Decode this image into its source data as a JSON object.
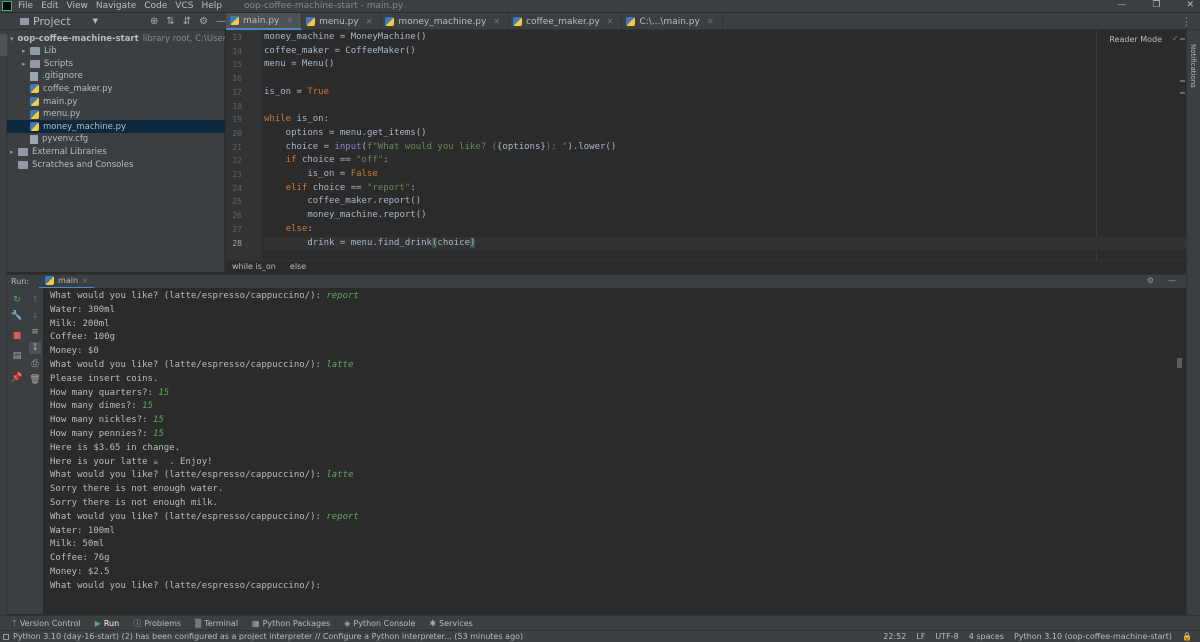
{
  "window": {
    "title": "oop-coffee-machine-start - main.py",
    "menu": [
      "File",
      "Edit",
      "View",
      "Navigate",
      "Code",
      "VCS",
      "Help"
    ]
  },
  "toolbar": {
    "project_selector": "Project",
    "tabs": [
      "main.py",
      "menu.py",
      "money_machine.py",
      "coffee_maker.py",
      "C:\\...\\main.py"
    ]
  },
  "project_tree": [
    {
      "label": "oop-coffee-machine-start",
      "hint": "library root,  C:\\Users\\SSLCor",
      "kind": "folder",
      "indent": 0,
      "expanded": true
    },
    {
      "label": "Lib",
      "kind": "folder",
      "indent": 1,
      "expanded": false
    },
    {
      "label": "Scripts",
      "kind": "folder",
      "indent": 1,
      "expanded": false
    },
    {
      "label": ".gitignore",
      "kind": "txt",
      "indent": 1
    },
    {
      "label": "coffee_maker.py",
      "kind": "py",
      "indent": 1
    },
    {
      "label": "main.py",
      "kind": "py",
      "indent": 1
    },
    {
      "label": "menu.py",
      "kind": "py",
      "indent": 1
    },
    {
      "label": "money_machine.py",
      "kind": "py",
      "indent": 1,
      "selected": true
    },
    {
      "label": "pyvenv.cfg",
      "kind": "txt",
      "indent": 1
    },
    {
      "label": "External Libraries",
      "kind": "folder",
      "indent": 0,
      "expanded": false
    },
    {
      "label": "Scratches and Consoles",
      "kind": "folder",
      "indent": 0
    }
  ],
  "editor": {
    "reader_mode": "Reader Mode",
    "lines": [
      {
        "n": "13",
        "html": "money_machine = MoneyMachine()"
      },
      {
        "n": "14",
        "html": "coffee_maker = CoffeeMaker()"
      },
      {
        "n": "15",
        "html": "menu = Menu()"
      },
      {
        "n": "16",
        "html": ""
      },
      {
        "n": "17",
        "html": "is_on = <span class=\"kw\">True</span>"
      },
      {
        "n": "18",
        "html": ""
      },
      {
        "n": "19",
        "html": "<span class=\"kw\">while</span> is_on:"
      },
      {
        "n": "20",
        "html": "    options = menu.get_items()"
      },
      {
        "n": "21",
        "html": "    choice = <span class=\"fn\">input</span>(<span class=\"str\">f\"What would you like? (</span>{options}<span class=\"str\">): \"</span>).lower()"
      },
      {
        "n": "22",
        "html": "    <span class=\"kw\">if</span> choice == <span class=\"str\">\"off\"</span>:"
      },
      {
        "n": "23",
        "html": "        is_on = <span class=\"kw\">False</span>"
      },
      {
        "n": "24",
        "html": "    <span class=\"kw\">elif</span> choice == <span class=\"str\">\"report\"</span>:"
      },
      {
        "n": "25",
        "html": "        coffee_maker.report()"
      },
      {
        "n": "26",
        "html": "        money_machine.report()"
      },
      {
        "n": "27",
        "html": "    <span class=\"kw\">else</span>:"
      },
      {
        "n": "28",
        "html": "        drink = menu.find_drink<span class=\"paren\">(</span>choice<span class=\"paren\">)</span>",
        "current": true
      }
    ],
    "breadcrumb": [
      "while is_on",
      "else"
    ]
  },
  "run": {
    "label": "Run:",
    "tab": "main",
    "output": [
      {
        "text": "What would you like? (latte/espresso/cappuccino/): ",
        "input": "report"
      },
      {
        "text": "Water: 300ml"
      },
      {
        "text": "Milk: 200ml"
      },
      {
        "text": "Coffee: 100g"
      },
      {
        "text": "Money: $0"
      },
      {
        "text": "What would you like? (latte/espresso/cappuccino/): ",
        "input": "latte"
      },
      {
        "text": "Please insert coins."
      },
      {
        "text": "How many quarters?: ",
        "input": "15"
      },
      {
        "text": "How many dimes?: ",
        "input": "15"
      },
      {
        "text": "How many nickles?: ",
        "input": "15"
      },
      {
        "text": "How many pennies?: ",
        "input": "15"
      },
      {
        "text": "Here is $3.65 in change."
      },
      {
        "text": "Here is your latte ☕  . Enjoy!"
      },
      {
        "text": "What would you like? (latte/espresso/cappuccino/): ",
        "input": "latte"
      },
      {
        "text": "Sorry there is not enough water."
      },
      {
        "text": "Sorry there is not enough milk."
      },
      {
        "text": "What would you like? (latte/espresso/cappuccino/): ",
        "input": "report"
      },
      {
        "text": "Water: 100ml"
      },
      {
        "text": "Milk: 50ml"
      },
      {
        "text": "Coffee: 76g"
      },
      {
        "text": "Money: $2.5"
      },
      {
        "text": "What would you like? (latte/espresso/cappuccino/): "
      }
    ]
  },
  "bottom_tabs": [
    "Version Control",
    "Run",
    "Problems",
    "Terminal",
    "Python Packages",
    "Python Console",
    "Services"
  ],
  "status": {
    "message": "Python 3.10 (day-16-start) (2) has been configured as a project interpreter // Configure a Python interpreter... (53 minutes ago)",
    "time": "22:52",
    "line_sep": "LF",
    "encoding": "UTF-8",
    "indent": "4 spaces",
    "interpreter": "Python 3.10 (oop-coffee-machine-start)"
  }
}
